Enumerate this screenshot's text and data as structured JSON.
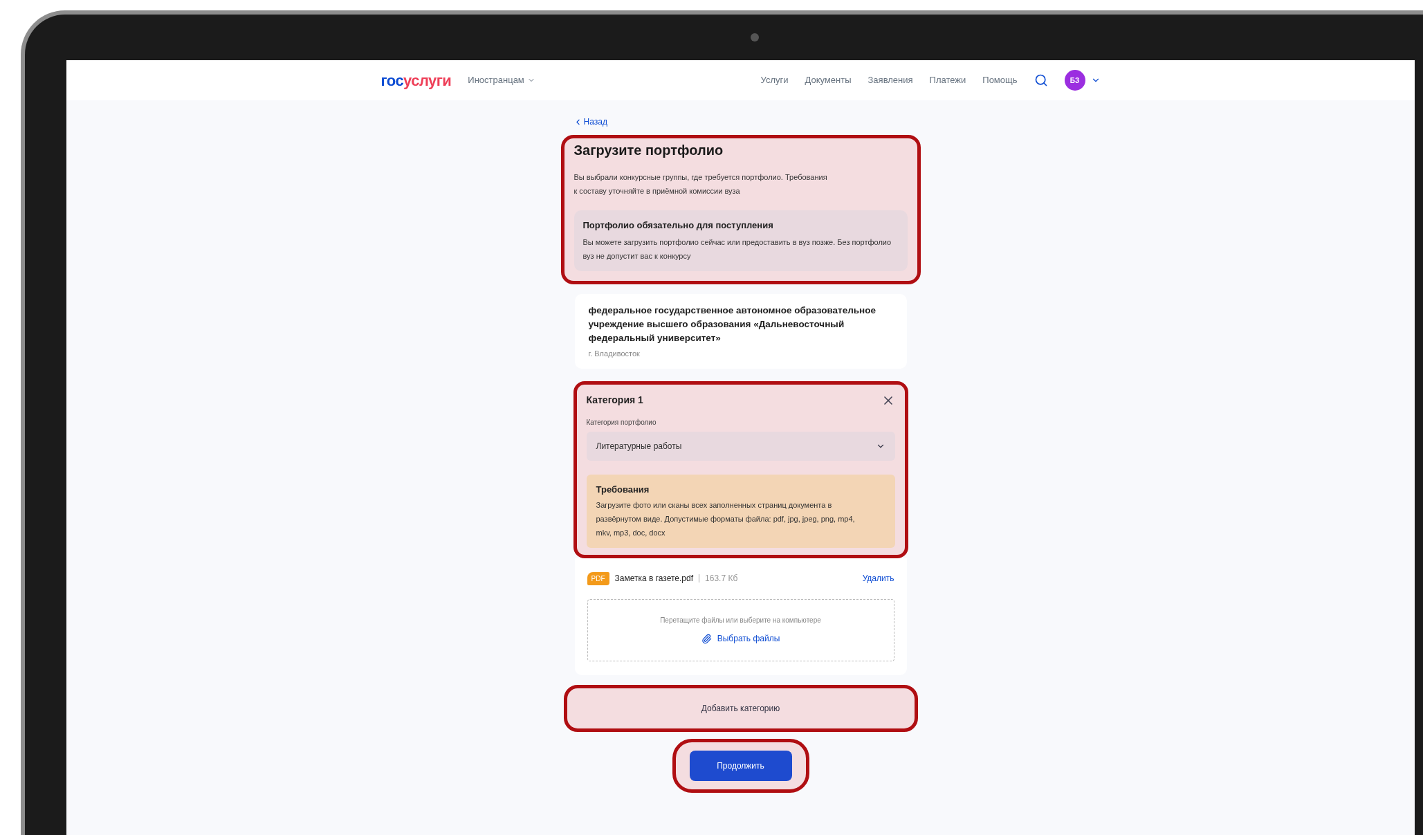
{
  "header": {
    "logo": {
      "first": "гос",
      "second": "услуги"
    },
    "menu": "Иностранцам",
    "nav": [
      "Услуги",
      "Документы",
      "Заявления",
      "Платежи",
      "Помощь"
    ],
    "avatar": "БЗ"
  },
  "back": "Назад",
  "intro": {
    "highlighted": true,
    "title": "Загрузите портфолио",
    "text": "Вы выбрали конкурсные группы, где требуется портфолио. Требования к составу уточняйте в приёмной комиссии вуза",
    "notice": {
      "title": "Портфолио обязательно для поступления",
      "text": "Вы можете загрузить портфолио сейчас или предоставить в вуз позже. Без портфолио вуз не допустит вас к конкурсу"
    }
  },
  "university": {
    "name": "федеральное государственное автономное образовательное учреждение высшего образования «Дальневосточный федеральный университет»",
    "city": "г. Владивосток"
  },
  "category": {
    "highlighted": true,
    "title": "Категория 1",
    "field_label": "Категория портфолио",
    "value": "Литературные работы",
    "requirements": {
      "title": "Требования",
      "text": "Загрузите фото или сканы всех заполненных страниц документа в развёрнутом виде. Допустимые форматы файла: pdf, jpg, jpeg, png, mp4, mkv, mp3, doc, docx"
    }
  },
  "file": {
    "badge": "PDF",
    "name": "Заметка в газете.pdf",
    "size": "163.7 Кб",
    "action": "Удалить"
  },
  "dropzone": {
    "hint": "Перетащите файлы или выберите на компьютере",
    "button": "Выбрать файлы"
  },
  "add_category": {
    "label": "Добавить категорию",
    "highlighted": true
  },
  "continue": {
    "label": "Продолжить",
    "highlighted": true
  }
}
